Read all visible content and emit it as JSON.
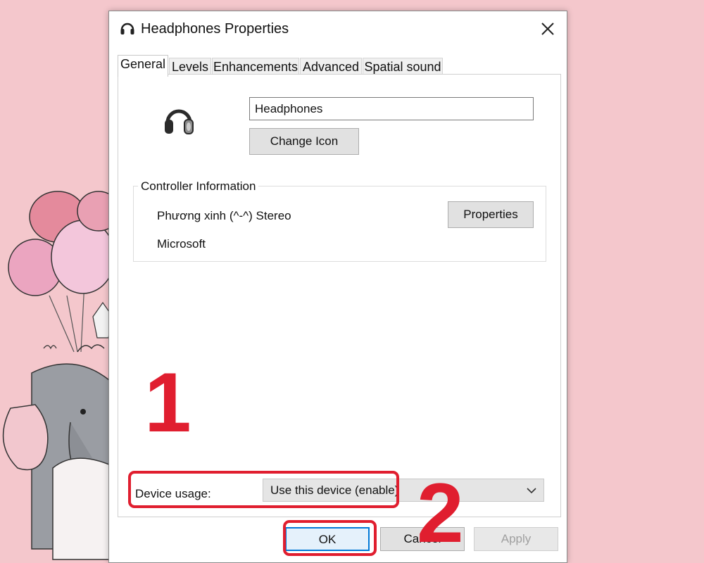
{
  "window": {
    "title": "Headphones Properties",
    "icon": "headphones-icon",
    "close_icon": "close-icon"
  },
  "tabs": [
    {
      "label": "General",
      "active": true
    },
    {
      "label": "Levels",
      "active": false
    },
    {
      "label": "Enhancements",
      "active": false
    },
    {
      "label": "Advanced",
      "active": false
    },
    {
      "label": "Spatial sound",
      "active": false
    }
  ],
  "general": {
    "device_icon": "headphones-icon",
    "device_name": "Headphones",
    "change_icon_label": "Change Icon",
    "controller": {
      "legend": "Controller Information",
      "name": "Phương xinh (^-^) Stereo",
      "manufacturer": "Microsoft",
      "properties_label": "Properties"
    },
    "device_usage": {
      "label": "Device usage:",
      "selected": "Use this device (enable)"
    }
  },
  "footer": {
    "ok_label": "OK",
    "cancel_label": "Cancel",
    "apply_label": "Apply"
  },
  "annotations": {
    "step1": "1",
    "step2": "2",
    "highlight_color": "#e01e2f"
  }
}
